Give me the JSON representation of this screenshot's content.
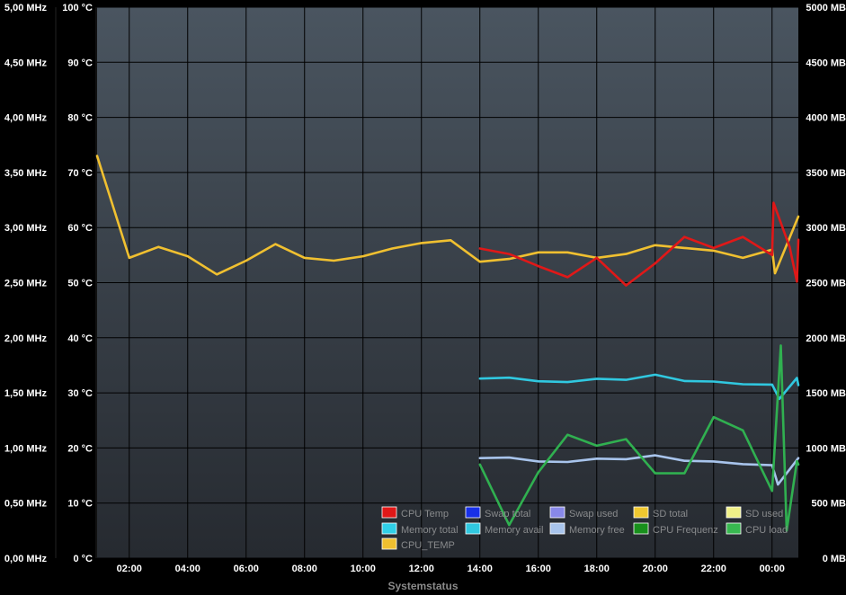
{
  "footer_label": "Systemstatus",
  "chart_data": {
    "type": "line",
    "xlabel": "Systemstatus",
    "x_ticks": [
      "02:00",
      "04:00",
      "06:00",
      "08:00",
      "10:00",
      "12:00",
      "14:00",
      "16:00",
      "18:00",
      "20:00",
      "22:00",
      "00:00"
    ],
    "axes": {
      "mhz": {
        "ticks": [
          "0,00 MHz",
          "0,50 MHz",
          "1,00 MHz",
          "1,50 MHz",
          "2,00 MHz",
          "2,50 MHz",
          "3,00 MHz",
          "3,50 MHz",
          "4,00 MHz",
          "4,50 MHz",
          "5,00 MHz"
        ],
        "ylim": [
          0,
          5
        ],
        "unit": "MHz"
      },
      "temp": {
        "ticks": [
          "0 °C",
          "10 °C",
          "20 °C",
          "30 °C",
          "40 °C",
          "50 °C",
          "60 °C",
          "70 °C",
          "80 °C",
          "90 °C",
          "100 °C"
        ],
        "ylim": [
          0,
          100
        ],
        "unit": "°C"
      },
      "mb": {
        "ticks": [
          "0 MB",
          "500 MB",
          "1000 MB",
          "1500 MB",
          "2000 MB",
          "2500 MB",
          "3000 MB",
          "3500 MB",
          "4000 MB",
          "4500 MB",
          "5000 MB"
        ],
        "ylim": [
          0,
          5000
        ],
        "unit": "MB"
      }
    },
    "x_range_hours": [
      0.9,
      24.9
    ],
    "series": [
      {
        "name": "CPU_TEMP",
        "color": "#f0c030",
        "axis": "temp",
        "points": [
          [
            0.9,
            73.0
          ],
          [
            2.0,
            54.5
          ],
          [
            3.0,
            56.5
          ],
          [
            4.0,
            54.8
          ],
          [
            5.0,
            51.5
          ],
          [
            6.0,
            54.0
          ],
          [
            7.0,
            57.0
          ],
          [
            8.0,
            54.5
          ],
          [
            9.0,
            54.0
          ],
          [
            10.0,
            54.8
          ],
          [
            11.0,
            56.2
          ],
          [
            12.0,
            57.2
          ],
          [
            13.0,
            57.7
          ],
          [
            14.0,
            53.8
          ],
          [
            15.0,
            54.3
          ],
          [
            16.0,
            55.5
          ],
          [
            17.0,
            55.5
          ],
          [
            18.0,
            54.5
          ],
          [
            19.0,
            55.2
          ],
          [
            20.0,
            56.8
          ],
          [
            21.0,
            56.3
          ],
          [
            22.0,
            55.8
          ],
          [
            23.0,
            54.5
          ],
          [
            24.0,
            56.0
          ],
          [
            24.1,
            51.7
          ],
          [
            24.9,
            62.0
          ]
        ]
      },
      {
        "name": "CPU Temp",
        "color": "#e01818",
        "axis": "temp",
        "points": [
          [
            14.0,
            56.2
          ],
          [
            15.0,
            55.2
          ],
          [
            16.0,
            53.0
          ],
          [
            17.0,
            51.0
          ],
          [
            18.0,
            54.5
          ],
          [
            19.0,
            49.5
          ],
          [
            20.0,
            53.5
          ],
          [
            21.0,
            58.3
          ],
          [
            22.0,
            56.3
          ],
          [
            23.0,
            58.3
          ],
          [
            24.0,
            55.0
          ],
          [
            24.05,
            64.5
          ],
          [
            24.6,
            56.5
          ],
          [
            24.85,
            50.2
          ],
          [
            24.9,
            57.8
          ]
        ]
      },
      {
        "name": "Memory total",
        "color": "#30c8e0",
        "axis": "mb",
        "points": [
          [
            14.0,
            1630
          ],
          [
            15.0,
            1638
          ],
          [
            16.0,
            1605
          ],
          [
            17.0,
            1598
          ],
          [
            18.0,
            1628
          ],
          [
            19.0,
            1618
          ],
          [
            20.0,
            1665
          ],
          [
            21.0,
            1608
          ],
          [
            22.0,
            1603
          ],
          [
            23.0,
            1578
          ],
          [
            24.0,
            1575
          ],
          [
            24.25,
            1445
          ],
          [
            24.85,
            1635
          ],
          [
            24.9,
            1570
          ]
        ]
      },
      {
        "name": "Memory free",
        "color": "#a8c4ec",
        "axis": "mb",
        "points": [
          [
            14.0,
            908
          ],
          [
            15.0,
            913
          ],
          [
            16.0,
            878
          ],
          [
            17.0,
            873
          ],
          [
            18.0,
            903
          ],
          [
            19.0,
            898
          ],
          [
            20.0,
            933
          ],
          [
            21.0,
            883
          ],
          [
            22.0,
            878
          ],
          [
            23.0,
            853
          ],
          [
            24.0,
            843
          ],
          [
            24.2,
            668
          ],
          [
            24.9,
            908
          ]
        ]
      },
      {
        "name": "CPU load",
        "color": "#30b050",
        "axis": "mhz",
        "points": [
          [
            14.0,
            0.85
          ],
          [
            15.0,
            0.3
          ],
          [
            16.0,
            0.78
          ],
          [
            17.0,
            1.12
          ],
          [
            18.0,
            1.02
          ],
          [
            19.0,
            1.08
          ],
          [
            20.0,
            0.77
          ],
          [
            21.0,
            0.77
          ],
          [
            22.0,
            1.28
          ],
          [
            23.0,
            1.16
          ],
          [
            24.0,
            0.61
          ],
          [
            24.3,
            1.93
          ],
          [
            24.5,
            0.25
          ],
          [
            24.85,
            0.88
          ],
          [
            24.9,
            0.85
          ]
        ]
      }
    ],
    "legend": {
      "placement": "bottom-right",
      "items": [
        {
          "label": "CPU Temp",
          "color": "#e01818"
        },
        {
          "label": "Swap total",
          "color": "#1830e8"
        },
        {
          "label": "Swap used",
          "color": "#8888e8"
        },
        {
          "label": "SD total",
          "color": "#f0c830"
        },
        {
          "label": "SD used",
          "color": "#f0f088"
        },
        {
          "label": "Memory total",
          "color": "#30d0e8"
        },
        {
          "label": "Memory avail",
          "color": "#30c8e0"
        },
        {
          "label": "Memory free",
          "color": "#a8c4ec"
        },
        {
          "label": "CPU Frequenz",
          "color": "#18901c"
        },
        {
          "label": "CPU load",
          "color": "#38b850"
        },
        {
          "label": "CPU_TEMP",
          "color": "#f0c030"
        }
      ]
    },
    "grid": true
  }
}
